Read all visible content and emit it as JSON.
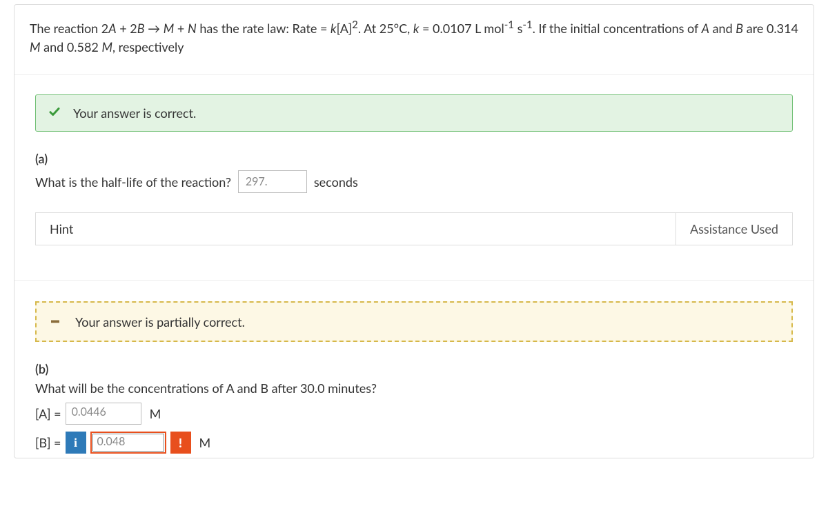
{
  "question": {
    "line1_prefix": "The reaction 2",
    "A": "A",
    "plus2B": " + 2",
    "B": "B",
    "arrow": " → ",
    "M": "M",
    "plus": " + ",
    "N": "N",
    "has_rate_law": " has the rate law: Rate = ",
    "k": "k",
    "bracketA": "[A]",
    "squared": "2",
    "period_at25": ". At 25°C, ",
    "k2": "k",
    "equals": " = 0.0107 L mol",
    "neg1a": "-1",
    "space_s": " s",
    "neg1b": "-1",
    "period_if": ". If the initial concentrations of ",
    "A2": "A",
    "and": " and ",
    "B2": "B",
    "are": " are 0.314 ",
    "M_unit1": "M",
    "and2": " and 0.582 ",
    "M_unit2": "M",
    "respectively": ", respectively"
  },
  "feedback": {
    "correct": "Your answer is correct.",
    "partial": "Your answer is partially correct."
  },
  "part_a": {
    "label": "(a)",
    "prompt": "What is the half-life of the reaction?",
    "answer": "297.",
    "unit": "seconds"
  },
  "hint": {
    "left": "Hint",
    "right": "Assistance Used"
  },
  "part_b": {
    "label": "(b)",
    "prompt": "What will be the concentrations of A and B after 30.0 minutes?",
    "rowA_label": "[A] =",
    "rowA_value": "0.0446",
    "rowA_unit": "M",
    "rowB_label": "[B] =",
    "rowB_value": "0.048",
    "rowB_unit": "M",
    "info_badge": "i",
    "wrong_badge": "!"
  }
}
